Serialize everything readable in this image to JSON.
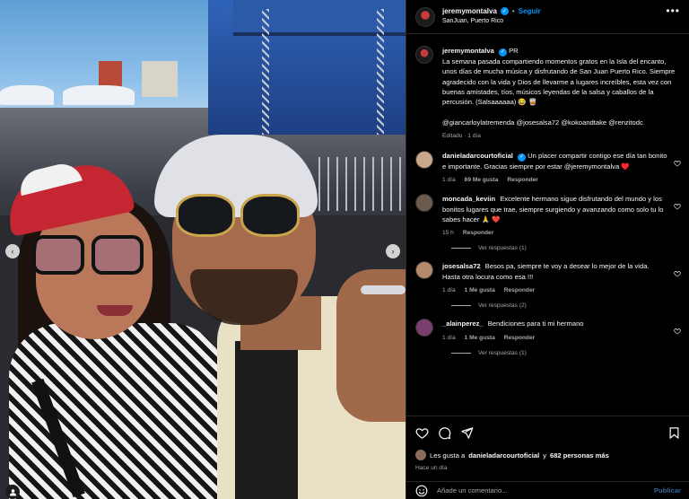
{
  "header": {
    "username": "jeremymontalva",
    "follow_label": "Seguir",
    "separator": "•",
    "location": "SanJuan, Puerto Rico",
    "more_label": "•••"
  },
  "caption": {
    "username": "jeremymontalva",
    "badge": "PR",
    "text": "La semana pasada compartiendo momentos gratos en la Isla del encanto, unos días de mucha música y disfrutando de San Juan Puerto Rico. Siempre agradecido con la vida y Dios de llevarme a lugares increíbles, esta vez con buenas amistades, tíos, músicos leyendas de la salsa y caballos de la percusión. (Salsaaaaaa) 😂 🥃",
    "mentions": "@giancarloylatremenda @josesalsa72 @kokoandtake @renzitodc",
    "edited": "Editado · 1 día"
  },
  "comments": [
    {
      "username": "danieladarcourtoficial",
      "verified": true,
      "text": "Un placer compartir contigo ese día tan bonito e importante. Gracias siempre por estar @jeremymontalva ♥️",
      "time": "1 día",
      "likes": "69 Me gusta",
      "reply": "Responder",
      "avatar_color": "#c9a78a"
    },
    {
      "username": "moncada_keviin",
      "verified": false,
      "text": "Excelente hermano sigue disfrutando del mundo y los bonitos lugares que trae, siempre surgiendo y avanzando como solo tu lo sabes hacer 🙏 ❤️",
      "time": "15 h",
      "likes": "",
      "reply": "Responder",
      "replies_label": "Ver respuestas (1)",
      "avatar_color": "#6c5a4c"
    },
    {
      "username": "josesalsa72",
      "verified": false,
      "text": "Besos pa, siempre te voy a desear lo mejor de la vida. Hasta otra locura como esa !!!",
      "time": "1 día",
      "likes": "1 Me gusta",
      "reply": "Responder",
      "replies_label": "Ver respuestas (2)",
      "avatar_color": "#b58a6a"
    },
    {
      "username": "_alainperez_",
      "verified": false,
      "text": "Bendiciones para ti mi hermano",
      "time": "1 día",
      "likes": "1 Me gusta",
      "reply": "Responder",
      "replies_label": "Ver respuestas (1)",
      "avatar_color": "#7a3f6e"
    }
  ],
  "likes_summary": {
    "prefix": "Les gusta a",
    "user": "danieladarcourtoficial",
    "middle": "y",
    "others": "682 personas más"
  },
  "post_time": "Hace un día",
  "add_comment": {
    "placeholder": "Añade un comentario...",
    "publish_label": "Publicar"
  },
  "photo": {
    "prev_label": "‹",
    "next_label": "›"
  },
  "colors": {
    "accent": "#0095f6",
    "heart": "#ed4956",
    "muted": "#a8a8a8"
  }
}
